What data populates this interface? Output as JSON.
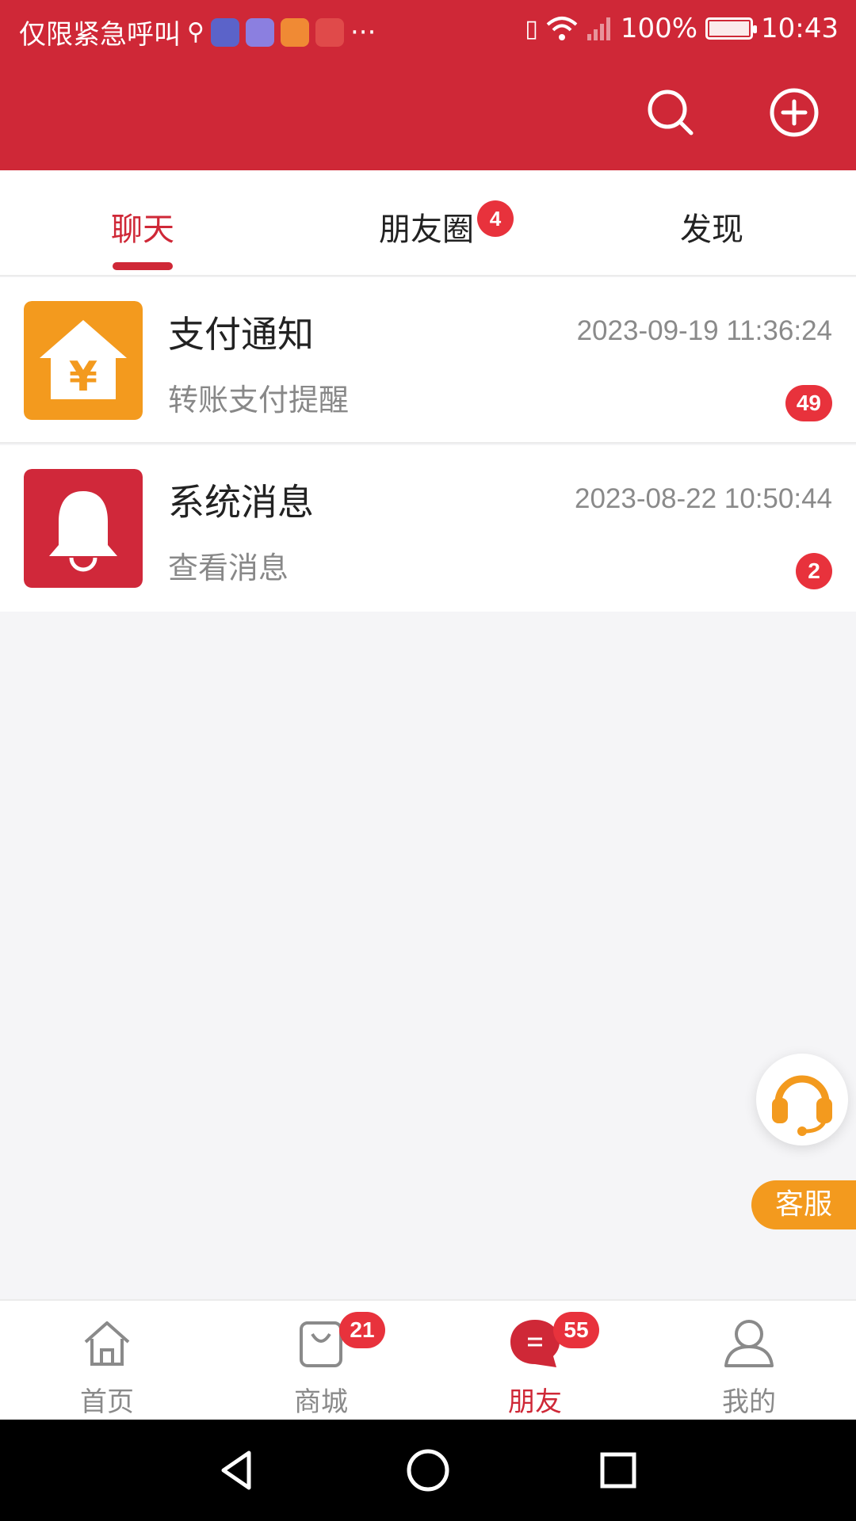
{
  "status_bar": {
    "carrier_text": "仅限紧急呼叫",
    "more": "···",
    "battery": "100%",
    "time": "10:43"
  },
  "header": {
    "search_icon": "search-icon",
    "add_icon": "plus-circle-icon"
  },
  "tabs": [
    {
      "label": "聊天",
      "active": true
    },
    {
      "label": "朋友圈",
      "badge": "4"
    },
    {
      "label": "发现"
    }
  ],
  "conversations": [
    {
      "title": "支付通知",
      "subtitle": "转账支付提醒",
      "time": "2023-09-19 11:36:24",
      "badge": "49",
      "icon": "yen-house-icon",
      "color": "#f39a1e"
    },
    {
      "title": "系统消息",
      "subtitle": "查看消息",
      "time": "2023-08-22 10:50:44",
      "badge": "2",
      "icon": "bell-icon",
      "color": "#d0283a"
    }
  ],
  "customer_service": {
    "label": "客服"
  },
  "bottom_nav": [
    {
      "label": "首页",
      "icon": "home-icon"
    },
    {
      "label": "商城",
      "icon": "shopping-bag-icon",
      "badge": "21"
    },
    {
      "label": "朋友",
      "icon": "chat-bubble-icon",
      "badge": "55",
      "active": true
    },
    {
      "label": "我的",
      "icon": "user-icon"
    }
  ],
  "colors": {
    "primary": "#cf2837",
    "badge": "#e8323c",
    "orange": "#f39a1e"
  }
}
